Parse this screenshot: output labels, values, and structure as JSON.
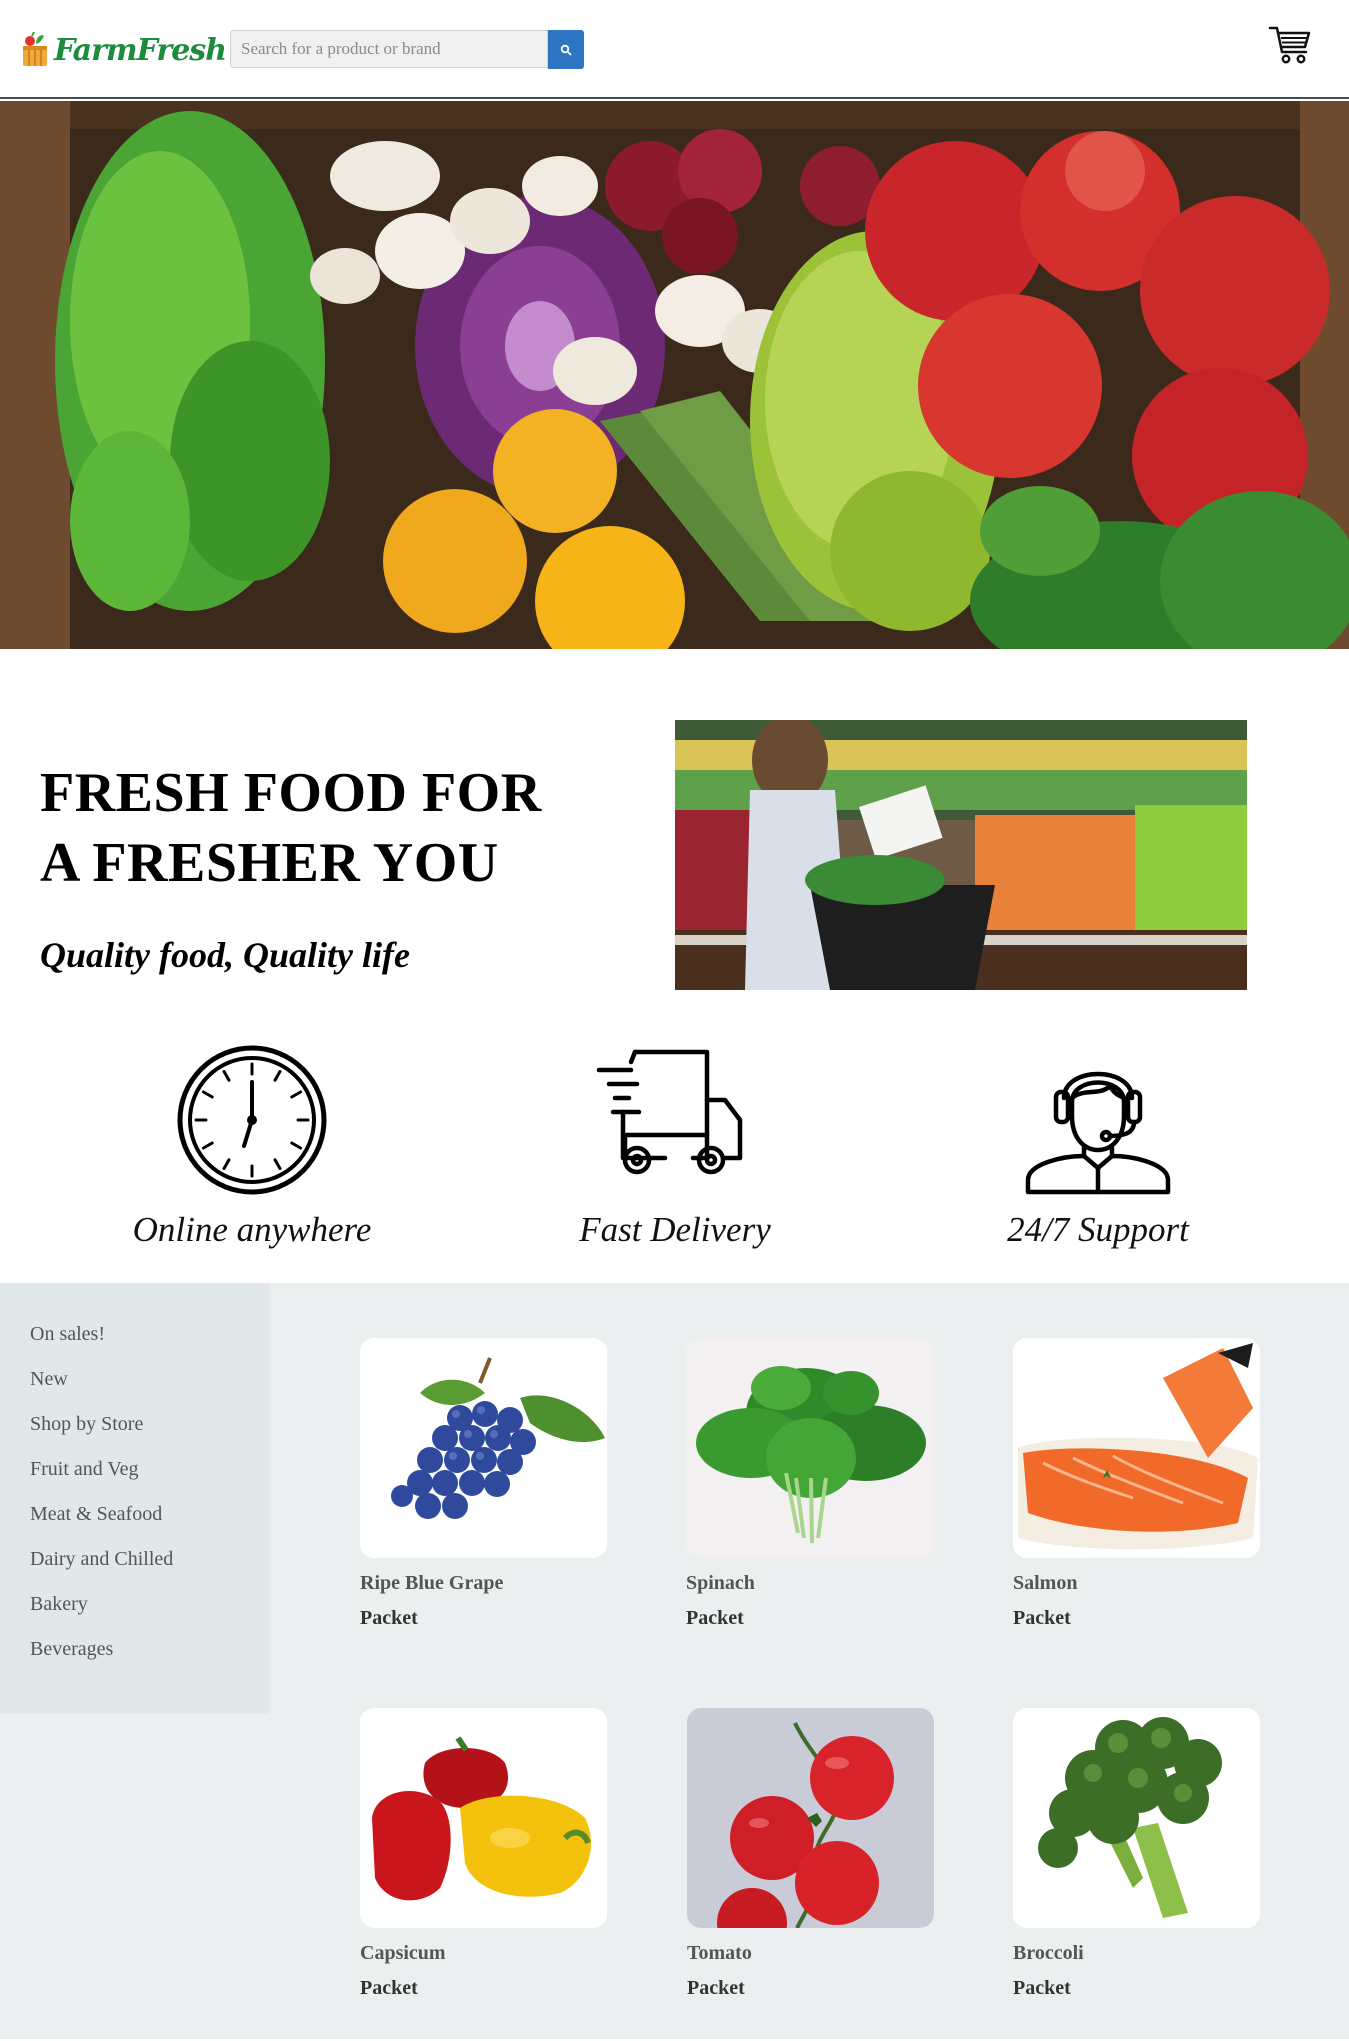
{
  "header": {
    "logo_text": "FarmFresh",
    "search_placeholder": "Search for a product or brand",
    "search_icon": "search-icon",
    "cart_icon": "shopping-cart-icon"
  },
  "intro": {
    "title_line1": "FRESH FOOD FOR",
    "title_line2": "A FRESHER YOU",
    "subtitle": "Quality food, Quality life"
  },
  "features": [
    {
      "icon": "clock-icon",
      "label": "Online anywhere"
    },
    {
      "icon": "delivery-truck-icon",
      "label": "Fast Delivery"
    },
    {
      "icon": "support-headset-icon",
      "label": "24/7 Support"
    }
  ],
  "sidebar": {
    "items": [
      {
        "label": "On sales!"
      },
      {
        "label": "New"
      },
      {
        "label": "Shop by Store"
      },
      {
        "label": "Fruit and Veg"
      },
      {
        "label": "Meat & Seafood"
      },
      {
        "label": "Dairy and Chilled"
      },
      {
        "label": "Bakery"
      },
      {
        "label": "Beverages"
      }
    ]
  },
  "products": [
    {
      "name": "Ripe Blue Grape",
      "unit": "Packet"
    },
    {
      "name": "Spinach",
      "unit": "Packet"
    },
    {
      "name": "Salmon",
      "unit": "Packet"
    },
    {
      "name": "Capsicum",
      "unit": "Packet"
    },
    {
      "name": "Tomato",
      "unit": "Packet"
    },
    {
      "name": "Broccoli",
      "unit": "Packet"
    }
  ],
  "colors": {
    "brand_green": "#1e8a3c",
    "search_button": "#2f76c2",
    "shop_background": "#ebeff0",
    "sidebar_background": "#e1e8e9"
  }
}
